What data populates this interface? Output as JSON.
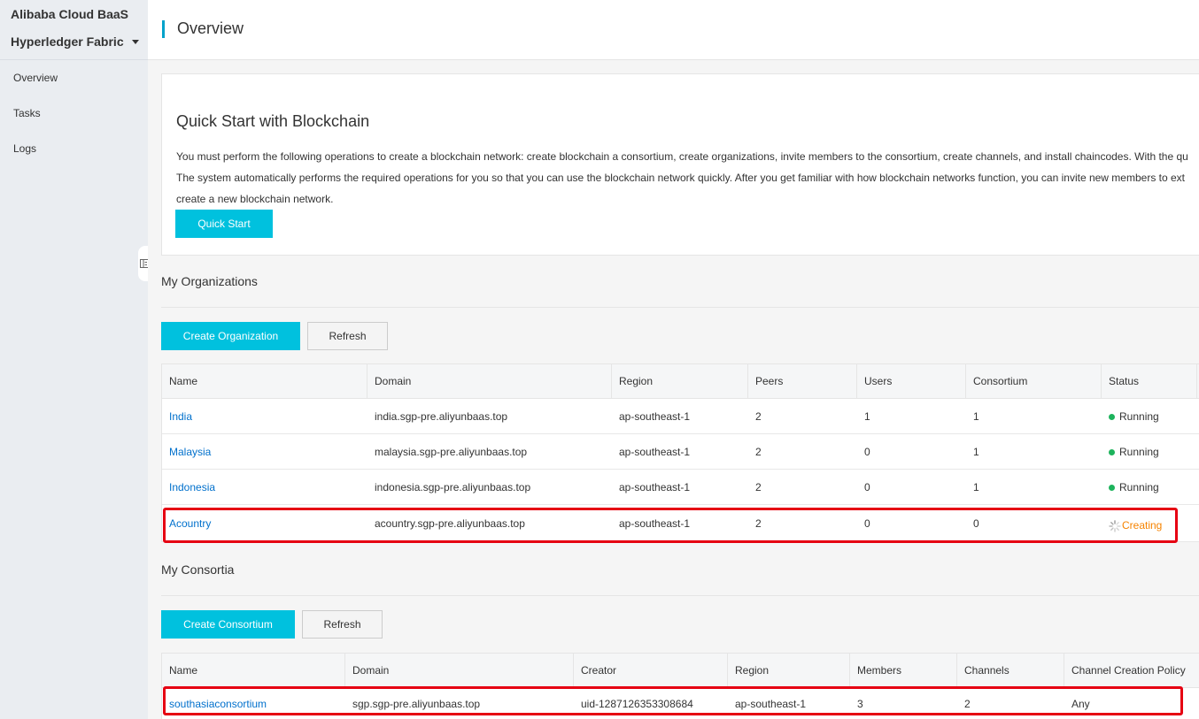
{
  "sidebar": {
    "brand": "Alibaba Cloud BaaS",
    "product": "Hyperledger Fabric",
    "items": [
      {
        "label": "Overview"
      },
      {
        "label": "Tasks"
      },
      {
        "label": "Logs"
      }
    ]
  },
  "header": {
    "title": "Overview"
  },
  "quick_start": {
    "title": "Quick Start with Blockchain",
    "line1": "You must perform the following operations to create a blockchain network: create blockchain a consortium, create organizations, invite members to the consortium, create channels, and install chaincodes. With the qu",
    "line2": "The system automatically performs the required operations for you so that you can use the blockchain network quickly. After you get familiar with how blockchain networks function, you can invite new members to ext",
    "line3": "create a new blockchain network.",
    "button": "Quick Start"
  },
  "organizations": {
    "title": "My Organizations",
    "create_button": "Create Organization",
    "refresh_button": "Refresh",
    "columns": [
      "Name",
      "Domain",
      "Region",
      "Peers",
      "Users",
      "Consortium",
      "Status"
    ],
    "rows": [
      {
        "name": "India",
        "domain": "india.sgp-pre.aliyunbaas.top",
        "region": "ap-southeast-1",
        "peers": "2",
        "users": "1",
        "consortium": "1",
        "status": "Running"
      },
      {
        "name": "Malaysia",
        "domain": "malaysia.sgp-pre.aliyunbaas.top",
        "region": "ap-southeast-1",
        "peers": "2",
        "users": "0",
        "consortium": "1",
        "status": "Running"
      },
      {
        "name": "Indonesia",
        "domain": "indonesia.sgp-pre.aliyunbaas.top",
        "region": "ap-southeast-1",
        "peers": "2",
        "users": "0",
        "consortium": "1",
        "status": "Running"
      },
      {
        "name": "Acountry",
        "domain": "acountry.sgp-pre.aliyunbaas.top",
        "region": "ap-southeast-1",
        "peers": "2",
        "users": "0",
        "consortium": "0",
        "status": "Creating"
      }
    ]
  },
  "consortia": {
    "title": "My Consortia",
    "create_button": "Create Consortium",
    "refresh_button": "Refresh",
    "columns": [
      "Name",
      "Domain",
      "Creator",
      "Region",
      "Members",
      "Channels",
      "Channel Creation Policy"
    ],
    "rows": [
      {
        "name": "southasiaconsortium",
        "domain": "sgp.sgp-pre.aliyunbaas.top",
        "creator": "uid-1287126353308684",
        "region": "ap-southeast-1",
        "members": "3",
        "channels": "2",
        "policy": "Any"
      }
    ]
  },
  "colors": {
    "accent": "#00c1de",
    "running": "#1db35c",
    "creating": "#f68300",
    "highlight": "#e60012",
    "link": "#0070cc"
  },
  "icons": {
    "product_dropdown": "caret-down-icon",
    "collapse": "collapse-sidebar-icon",
    "status_running": "green-dot-icon",
    "status_creating": "spinner-icon"
  }
}
